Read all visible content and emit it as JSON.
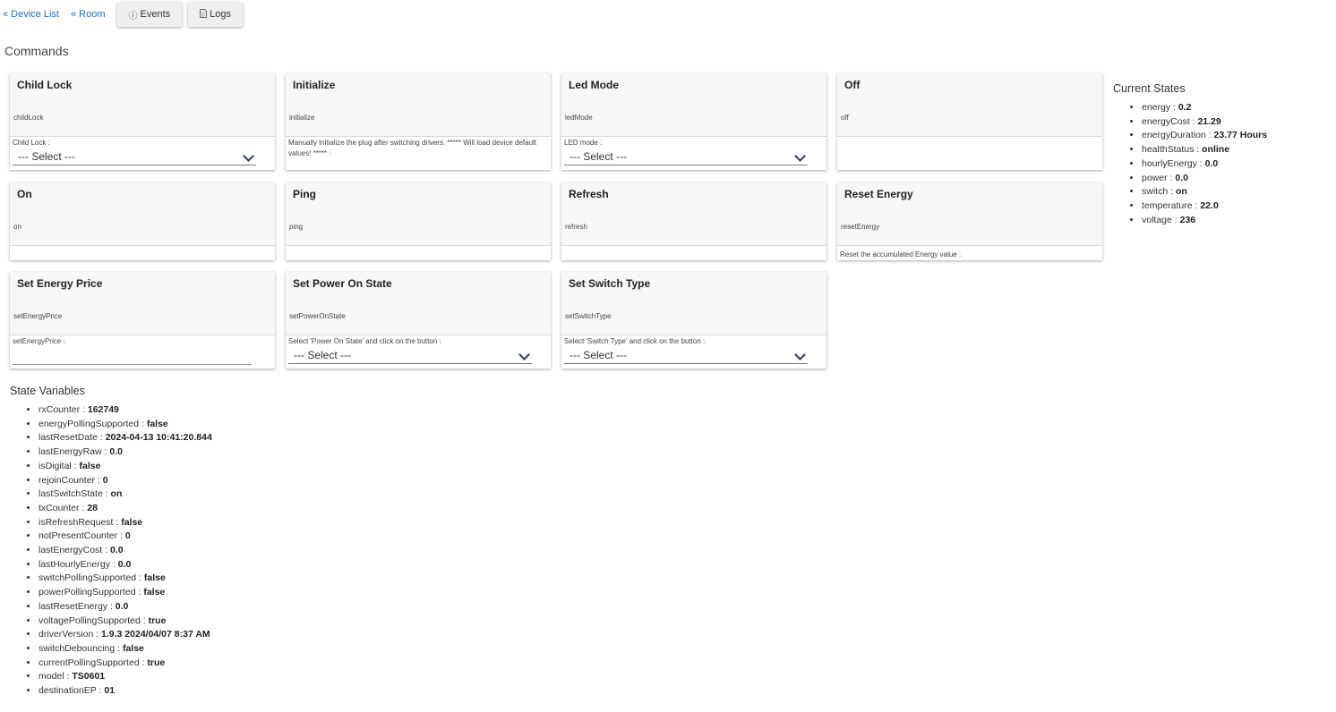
{
  "nav": {
    "device_list": "« Device List",
    "room": "« Room",
    "events_label": "Events",
    "logs_label": "Logs",
    "events_icon": "info-circle-icon",
    "logs_icon": "document-icon"
  },
  "commands_title": "Commands",
  "commands": [
    {
      "title": "Child Lock",
      "cmd": "childLock",
      "param_label": "Child Lock :",
      "select_value": "--- Select ---"
    },
    {
      "title": "Initialize",
      "cmd": "initialize",
      "param_label": "Manually initialize the plug after switching drivers. ***** Will load device default values! ***** :"
    },
    {
      "title": "Led Mode",
      "cmd": "ledMode",
      "param_label": "LED mode :",
      "select_value": "--- Select ---"
    },
    {
      "title": "Off",
      "cmd": "off"
    },
    {
      "title": "On",
      "cmd": "on"
    },
    {
      "title": "Ping",
      "cmd": "ping"
    },
    {
      "title": "Refresh",
      "cmd": "refresh"
    },
    {
      "title": "Reset Energy",
      "cmd": "resetEnergy",
      "param_label": "Reset the accumulated Energy value :"
    },
    {
      "title": "Set Energy Price",
      "cmd": "setEnergyPrice",
      "param_label": "setEnergyPrice :"
    },
    {
      "title": "Set Power On State",
      "cmd": "setPowerOnState",
      "param_label": "Select 'Power On State' and click on the button :",
      "select_value": "--- Select ---"
    },
    {
      "title": "Set Switch Type",
      "cmd": "setSwitchType",
      "param_label": "Select 'Switch Type' and click on the button :",
      "select_value": "--- Select ---"
    }
  ],
  "current_states": {
    "title": "Current States",
    "items": [
      {
        "key": "energy",
        "value": "0.2"
      },
      {
        "key": "energyCost",
        "value": "21.29"
      },
      {
        "key": "energyDuration",
        "value": "23.77 Hours"
      },
      {
        "key": "healthStatus",
        "value": "online"
      },
      {
        "key": "hourlyEnergy",
        "value": "0.0"
      },
      {
        "key": "power",
        "value": "0.0"
      },
      {
        "key": "switch",
        "value": "on"
      },
      {
        "key": "temperature",
        "value": "22.0"
      },
      {
        "key": "voltage",
        "value": "236"
      }
    ]
  },
  "state_variables": {
    "title": "State Variables",
    "items": [
      {
        "key": "rxCounter",
        "value": "162749"
      },
      {
        "key": "energyPollingSupported",
        "value": "false"
      },
      {
        "key": "lastResetDate",
        "value": "2024-04-13 10:41:20.844"
      },
      {
        "key": "lastEnergyRaw",
        "value": "0.0"
      },
      {
        "key": "isDigital",
        "value": "false"
      },
      {
        "key": "rejoinCounter",
        "value": "0"
      },
      {
        "key": "lastSwitchState",
        "value": "on"
      },
      {
        "key": "txCounter",
        "value": "28"
      },
      {
        "key": "isRefreshRequest",
        "value": "false"
      },
      {
        "key": "notPresentCounter",
        "value": "0"
      },
      {
        "key": "lastEnergyCost",
        "value": "0.0"
      },
      {
        "key": "lastHourlyEnergy",
        "value": "0.0"
      },
      {
        "key": "switchPollingSupported",
        "value": "false"
      },
      {
        "key": "powerPollingSupported",
        "value": "false"
      },
      {
        "key": "lastResetEnergy",
        "value": "0.0"
      },
      {
        "key": "voltagePollingSupported",
        "value": "true"
      },
      {
        "key": "driverVersion",
        "value": "1.9.3 2024/04/07 8:37 AM"
      },
      {
        "key": "switchDebouncing",
        "value": "false"
      },
      {
        "key": "currentPollingSupported",
        "value": "true"
      },
      {
        "key": "model",
        "value": "TS0601"
      },
      {
        "key": "destinationEP",
        "value": "01"
      }
    ]
  }
}
